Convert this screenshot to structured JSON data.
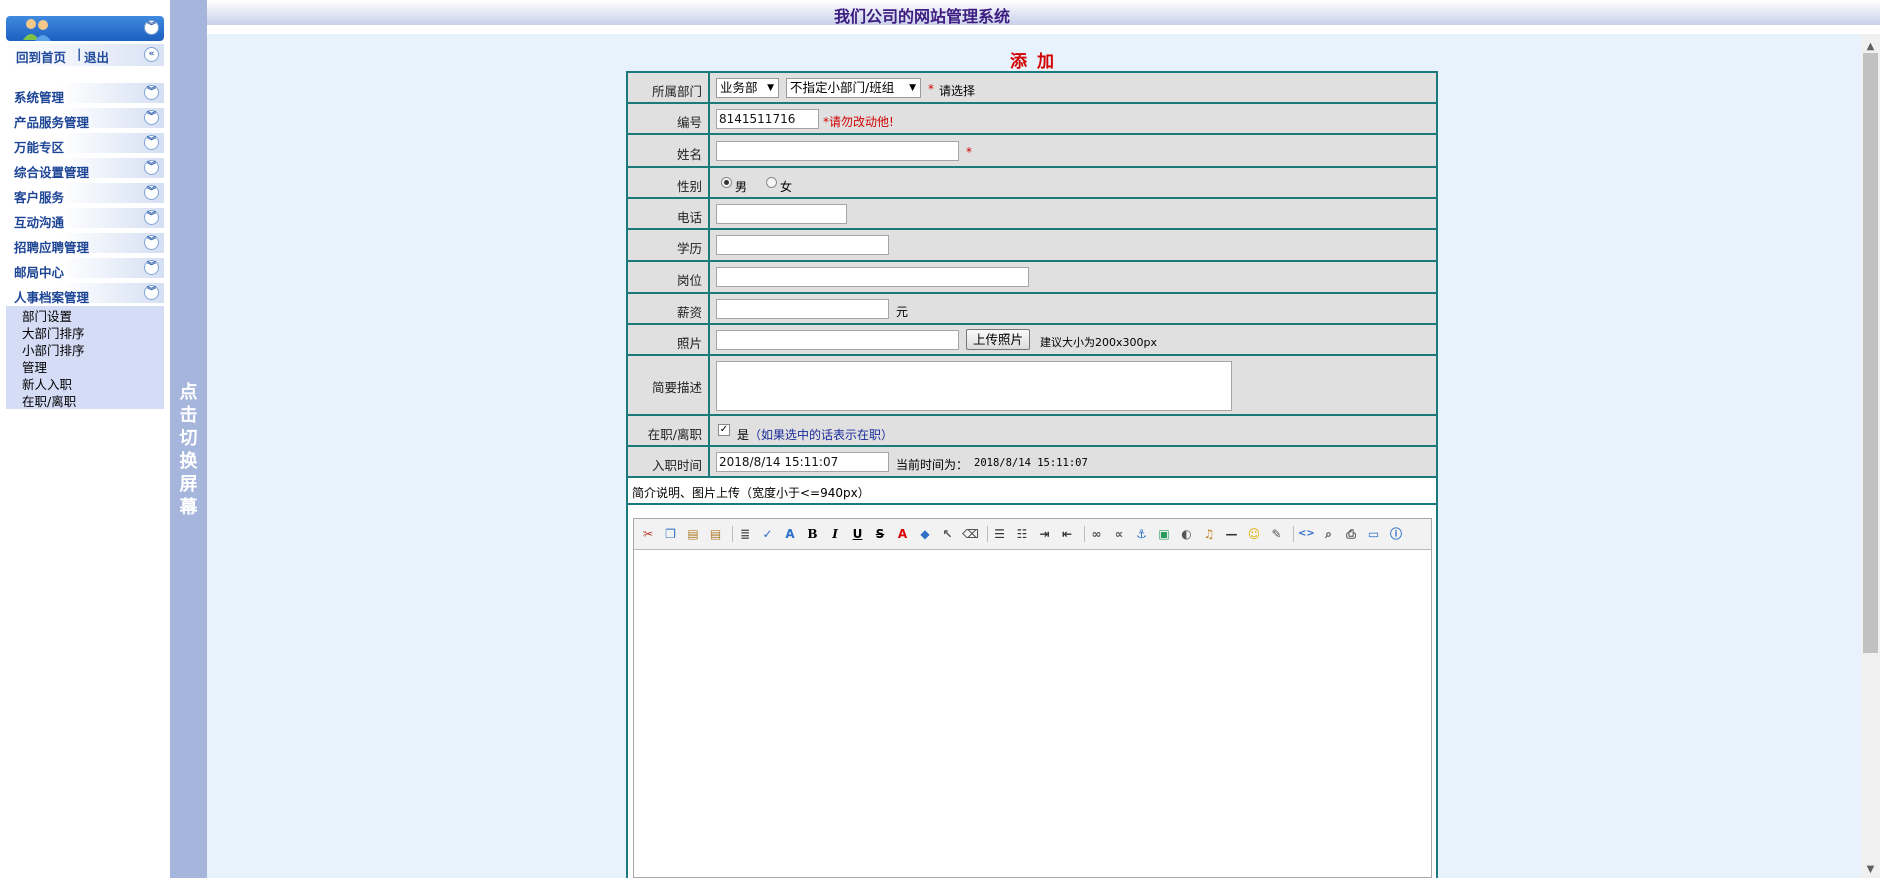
{
  "app": {
    "title": "我们公司的网站管理系统"
  },
  "quick_links": {
    "home": "回到首页",
    "separator": "|",
    "logout": "退出"
  },
  "menu": [
    {
      "label": "系统管理"
    },
    {
      "label": "产品服务管理"
    },
    {
      "label": "万能专区"
    },
    {
      "label": "综合设置管理"
    },
    {
      "label": "客户服务"
    },
    {
      "label": "互动沟通"
    },
    {
      "label": "招聘应聘管理"
    },
    {
      "label": "邮局中心"
    },
    {
      "label": "人事档案管理"
    }
  ],
  "submenu": [
    "部门设置",
    "大部门排序",
    "小部门排序",
    "管理",
    "新人入职",
    "在职/离职"
  ],
  "toggle_bar": {
    "text": "点击切换屏幕"
  },
  "page": {
    "title": "添加"
  },
  "form": {
    "department": {
      "label": "所属部门",
      "big_selected": "业务部",
      "small_selected": "不指定小部门/班组",
      "required_mark": "*",
      "hint": "请选择"
    },
    "number": {
      "label": "编号",
      "value": "8141511716",
      "hint": "*请勿改动他!"
    },
    "name": {
      "label": "姓名",
      "value": "",
      "required_mark": "*"
    },
    "gender": {
      "label": "性别",
      "options": [
        "男",
        "女"
      ],
      "selected": "男"
    },
    "phone": {
      "label": "电话",
      "value": ""
    },
    "education": {
      "label": "学历",
      "value": ""
    },
    "position": {
      "label": "岗位",
      "value": ""
    },
    "salary": {
      "label": "薪资",
      "value": "",
      "unit": "元"
    },
    "photo": {
      "label": "照片",
      "value": "",
      "button": "上传照片",
      "hint": "建议大小为200x300px"
    },
    "description": {
      "label": "简要描述",
      "value": ""
    },
    "status": {
      "label": "在职/离职",
      "checked": true,
      "check_label": "是",
      "note": "（如果选中的话表示在职）"
    },
    "hire_time": {
      "label": "入职时间",
      "value": "2018/8/14 15:11:07",
      "current_label": "当前时间为：",
      "current_value": "2018/8/14 15:11:07"
    },
    "intro": {
      "label": "简介说明、图片上传（宽度小于<=940px）"
    }
  },
  "editor": {
    "toolbar_icons": [
      "cut-icon",
      "copy-icon",
      "paste-icon",
      "paste-text-icon",
      "sep",
      "format-block-icon",
      "spellcheck-icon",
      "font-icon",
      "bold-icon",
      "italic-icon",
      "underline-icon",
      "strikethrough-icon",
      "font-color-icon",
      "background-color-icon",
      "select-icon",
      "remove-format-icon",
      "sep",
      "align-left-icon",
      "list-icon",
      "indent-icon",
      "outdent-icon",
      "sep",
      "link-icon",
      "unlink-icon",
      "anchor-icon",
      "image-icon",
      "flash-icon",
      "media-icon",
      "horizontal-rule-icon",
      "smiley-icon",
      "edit-icon",
      "sep",
      "source-icon",
      "preview-icon",
      "print-icon",
      "fullscreen-icon",
      "about-icon"
    ]
  },
  "colors": {
    "accent": "#1b7b7b",
    "menu_blue": "#1d4595",
    "sidebar_toggle": "#a6b5dc",
    "content_bg": "#e8f2fd",
    "title_red": "#d20000"
  }
}
